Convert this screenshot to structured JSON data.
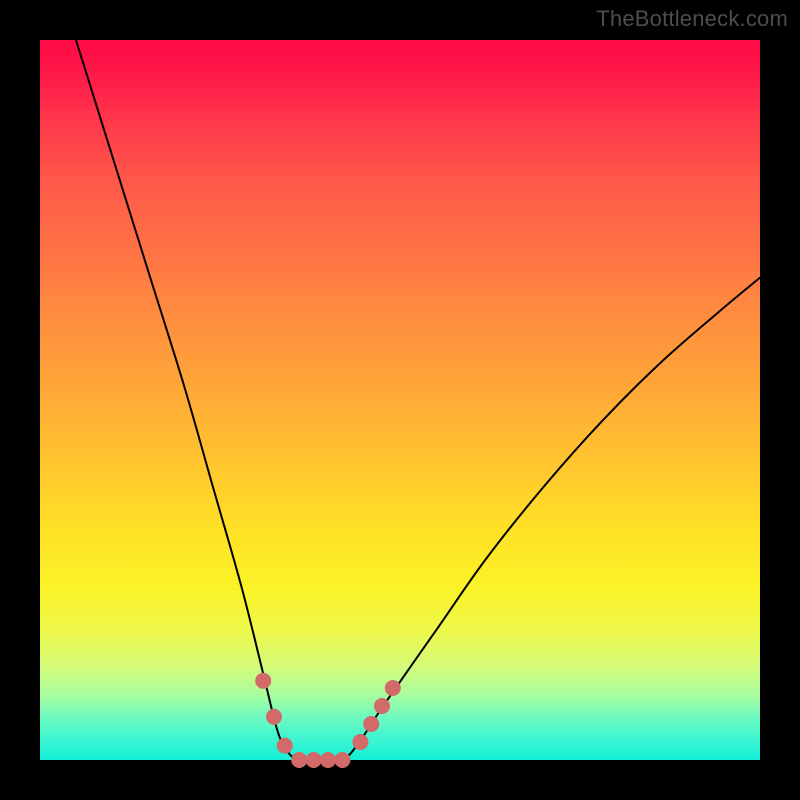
{
  "watermark": "TheBottleneck.com",
  "chart_data": {
    "type": "line",
    "title": "",
    "xlabel": "",
    "ylabel": "",
    "xlim": [
      0,
      100
    ],
    "ylim": [
      0,
      100
    ],
    "grid": false,
    "series": [
      {
        "name": "bottleneck-curve",
        "color": "#000000",
        "width": 2,
        "x": [
          5,
          10,
          15,
          20,
          24,
          28,
          31,
          33,
          34.5,
          36,
          38,
          40,
          42,
          44,
          48,
          55,
          62,
          70,
          78,
          86,
          94,
          100
        ],
        "values": [
          100,
          84,
          68,
          52,
          38,
          24,
          12,
          4,
          1,
          0,
          0,
          0,
          0,
          2,
          8,
          18,
          28,
          38,
          47,
          55,
          62,
          67
        ]
      }
    ],
    "overlays": [
      {
        "name": "highlight-dots",
        "color": "#d36a6a",
        "radius": 8,
        "points_x": [
          31.0,
          32.5,
          34.0,
          36.0,
          38.0,
          40.0,
          42.0,
          44.5,
          46.0,
          47.5,
          49.0
        ],
        "points_y": [
          11.0,
          6.0,
          2.0,
          0.0,
          0.0,
          0.0,
          0.0,
          2.5,
          5.0,
          7.5,
          10.0
        ]
      }
    ]
  }
}
